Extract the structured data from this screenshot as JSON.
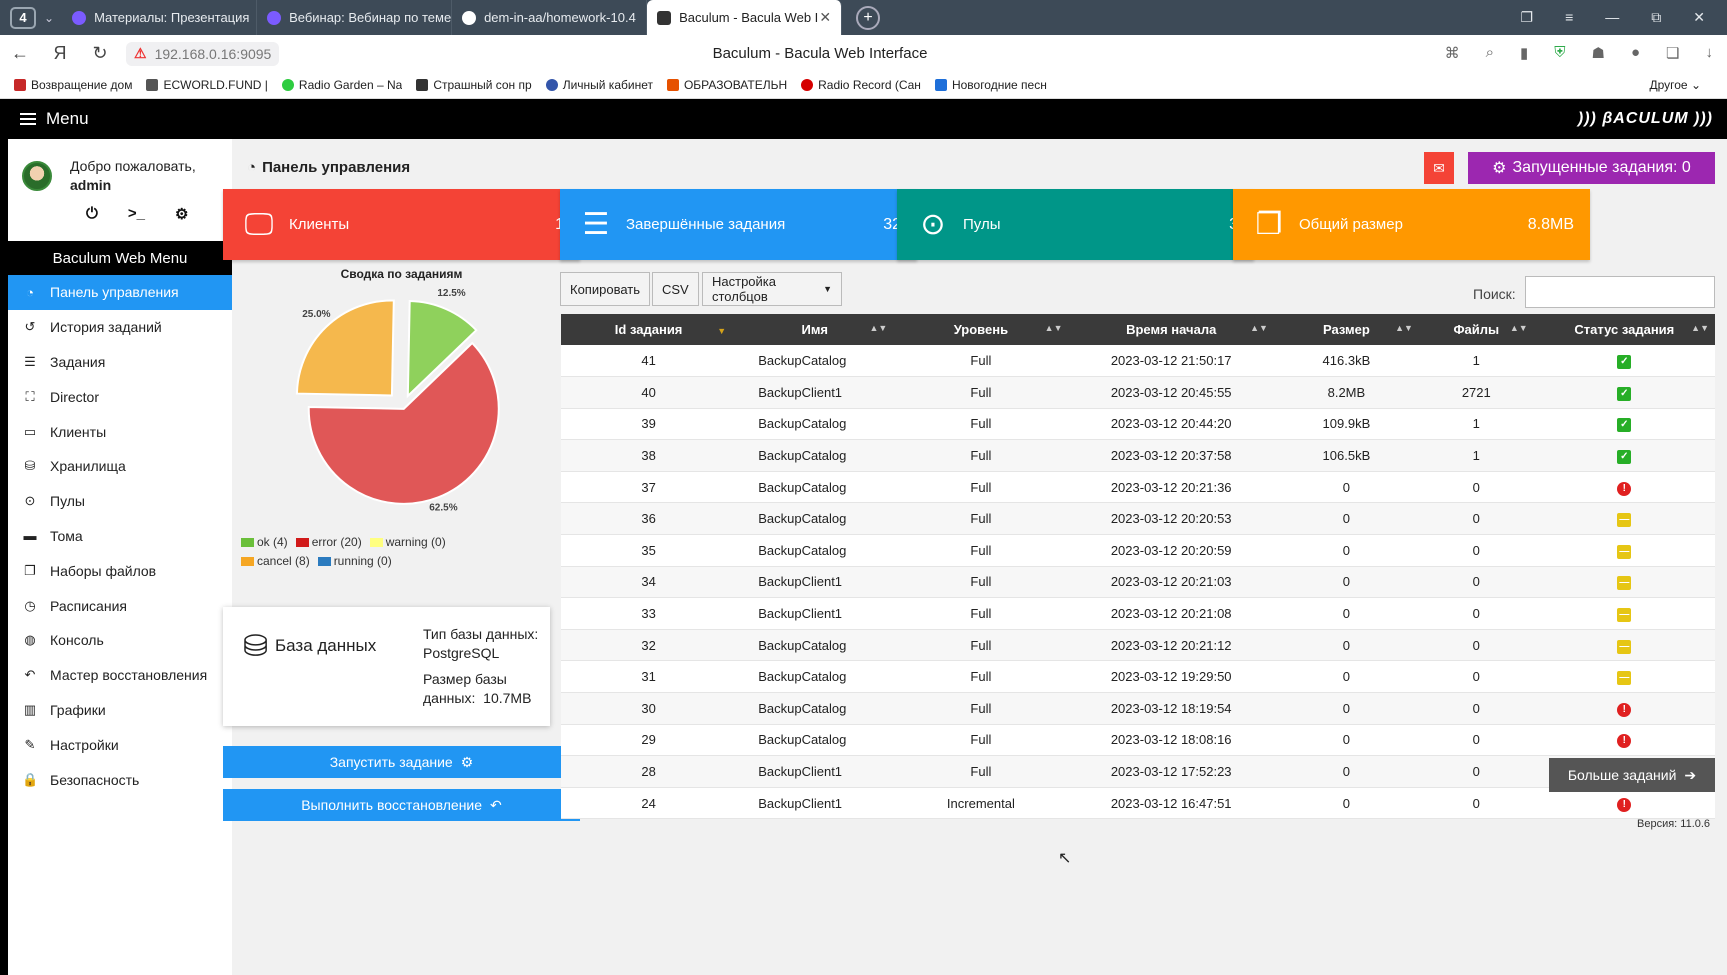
{
  "browser": {
    "tab_count": "4",
    "tabs": [
      {
        "title": "Материалы: Презентация",
        "color": "#7b5bff"
      },
      {
        "title": "Вебинар: Вебинар по теме",
        "color": "#7b5bff"
      },
      {
        "title": "dem-in-aa/homework-10.4",
        "color": "#ffffff"
      },
      {
        "title": "Baculum - Bacula Web I",
        "color": "#333333"
      }
    ],
    "url": "192.168.0.16:9095",
    "page_title": "Baculum - Bacula Web Interface",
    "bookmarks": [
      {
        "label": "Возвращение дом",
        "color": "#c62828"
      },
      {
        "label": "ECWORLD.FUND |",
        "color": "#555555"
      },
      {
        "label": "Radio Garden – Na",
        "color": "#2ecc40"
      },
      {
        "label": "Страшный сон пр",
        "color": "#333333"
      },
      {
        "label": "Личный кабинет",
        "color": "#3355aa"
      },
      {
        "label": "ОБРАЗОВАТЕЛЬН",
        "color": "#e65100"
      },
      {
        "label": "Radio Record (Сан",
        "color": "#d50000"
      },
      {
        "label": "Новогодние песн",
        "color": "#1e6fd9"
      }
    ],
    "other_bookmarks": "Другое"
  },
  "app": {
    "menu_label": "Menu",
    "logo": "))) βACULUM )))"
  },
  "sidebar": {
    "welcome": "Добро пожаловать,",
    "username": "admin",
    "menu_title": "Baculum Web Menu",
    "items": [
      {
        "label": "Панель управления",
        "icon": "dashboard-icon"
      },
      {
        "label": "История заданий",
        "icon": "history-icon"
      },
      {
        "label": "Задания",
        "icon": "tasks-icon"
      },
      {
        "label": "Director",
        "icon": "sitemap-icon"
      },
      {
        "label": "Клиенты",
        "icon": "desktop-icon"
      },
      {
        "label": "Хранилища",
        "icon": "database-icon"
      },
      {
        "label": "Пулы",
        "icon": "tape-icon"
      },
      {
        "label": "Тома",
        "icon": "hdd-icon"
      },
      {
        "label": "Наборы файлов",
        "icon": "copy-icon"
      },
      {
        "label": "Расписания",
        "icon": "clock-icon"
      },
      {
        "label": "Консоль",
        "icon": "globe-icon"
      },
      {
        "label": "Мастер восстановления",
        "icon": "undo-icon"
      },
      {
        "label": "Графики",
        "icon": "chart-icon"
      },
      {
        "label": "Настройки",
        "icon": "wrench-icon"
      },
      {
        "label": "Безопасность",
        "icon": "lock-icon"
      }
    ]
  },
  "dashboard": {
    "title": "Панель управления",
    "running_jobs": "Запущенные задания: 0",
    "cards": [
      {
        "label": "Клиенты",
        "value": "1",
        "color": "#f44336"
      },
      {
        "label": "Завершённые задания",
        "value": "32",
        "color": "#2196f3"
      },
      {
        "label": "Пулы",
        "value": "3",
        "color": "#009688"
      },
      {
        "label": "Общий размер",
        "value": "8.8MB",
        "color": "#ff9800"
      }
    ],
    "summary_title": "Сводка по заданиям",
    "db": {
      "name": "База данных",
      "type_label": "Тип базы данных:",
      "type_value": "PostgreSQL",
      "size_label": "Размер базы данных:",
      "size_value": "10.7MB"
    },
    "run_job_button": "Запустить задание",
    "restore_button": "Выполнить восстановление"
  },
  "chart_data": {
    "type": "pie",
    "title": "Сводка по заданиям",
    "slices": [
      {
        "label": "ok",
        "count": 4,
        "percent": 12.5,
        "color": "#8fd15c"
      },
      {
        "label": "error",
        "count": 20,
        "percent": 62.5,
        "color": "#e05757"
      },
      {
        "label": "warning",
        "count": 0,
        "percent": 0,
        "color": "#f7f06b"
      },
      {
        "label": "cancel",
        "count": 8,
        "percent": 25.0,
        "color": "#f5b84d"
      },
      {
        "label": "running",
        "count": 0,
        "percent": 0,
        "color": "#3b7dc4"
      }
    ],
    "legend": [
      {
        "text": "ok (4)",
        "color": "#6abf3a"
      },
      {
        "text": "error (20)",
        "color": "#d11a1a"
      },
      {
        "text": "warning (0)",
        "color": "#ffff80"
      },
      {
        "text": "cancel (8)",
        "color": "#f5a623"
      },
      {
        "text": "running (0)",
        "color": "#2b7bbf"
      }
    ],
    "slice_labels": [
      "12.5%",
      "62.5%",
      "25.0%"
    ]
  },
  "table": {
    "copy_button": "Копировать",
    "csv_button": "CSV",
    "columns_button": "Настройка столбцов",
    "search_label": "Поиск:",
    "headers": [
      "Id задания",
      "Имя",
      "Уровень",
      "Время начала",
      "Размер",
      "Файлы",
      "Статус задания"
    ],
    "rows": [
      [
        "41",
        "BackupCatalog",
        "Full",
        "2023-03-12 21:50:17",
        "416.3kB",
        "1",
        "ok"
      ],
      [
        "40",
        "BackupClient1",
        "Full",
        "2023-03-12 20:45:55",
        "8.2MB",
        "2721",
        "ok"
      ],
      [
        "39",
        "BackupCatalog",
        "Full",
        "2023-03-12 20:44:20",
        "109.9kB",
        "1",
        "ok"
      ],
      [
        "38",
        "BackupCatalog",
        "Full",
        "2023-03-12 20:37:58",
        "106.5kB",
        "1",
        "ok"
      ],
      [
        "37",
        "BackupCatalog",
        "Full",
        "2023-03-12 20:21:36",
        "0",
        "0",
        "error"
      ],
      [
        "36",
        "BackupCatalog",
        "Full",
        "2023-03-12 20:20:53",
        "0",
        "0",
        "cancel"
      ],
      [
        "35",
        "BackupCatalog",
        "Full",
        "2023-03-12 20:20:59",
        "0",
        "0",
        "cancel"
      ],
      [
        "34",
        "BackupClient1",
        "Full",
        "2023-03-12 20:21:03",
        "0",
        "0",
        "cancel"
      ],
      [
        "33",
        "BackupClient1",
        "Full",
        "2023-03-12 20:21:08",
        "0",
        "0",
        "cancel"
      ],
      [
        "32",
        "BackupCatalog",
        "Full",
        "2023-03-12 20:21:12",
        "0",
        "0",
        "cancel"
      ],
      [
        "31",
        "BackupCatalog",
        "Full",
        "2023-03-12 19:29:50",
        "0",
        "0",
        "cancel"
      ],
      [
        "30",
        "BackupCatalog",
        "Full",
        "2023-03-12 18:19:54",
        "0",
        "0",
        "error"
      ],
      [
        "29",
        "BackupCatalog",
        "Full",
        "2023-03-12 18:08:16",
        "0",
        "0",
        "error"
      ],
      [
        "28",
        "BackupClient1",
        "Full",
        "2023-03-12 17:52:23",
        "0",
        "0",
        "cancel"
      ],
      [
        "24",
        "BackupClient1",
        "Incremental",
        "2023-03-12 16:47:51",
        "0",
        "0",
        "error"
      ]
    ],
    "more_button": "Больше заданий",
    "version": "Версия: 11.0.6"
  }
}
